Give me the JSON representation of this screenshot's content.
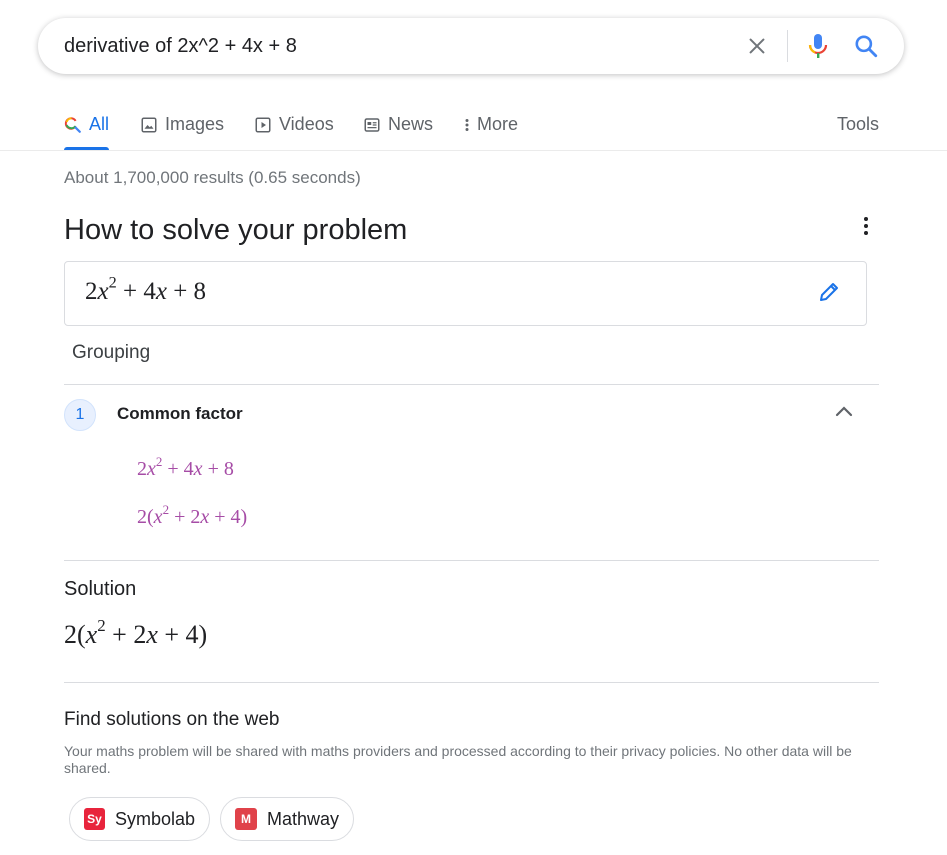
{
  "search": {
    "query": "derivative of 2x^2 + 4x + 8",
    "icons": [
      "close-icon",
      "microphone-icon",
      "search-icon"
    ]
  },
  "tabs": [
    {
      "label": "All",
      "icon": "search-icon",
      "active": true
    },
    {
      "label": "Images",
      "icon": "image-icon"
    },
    {
      "label": "Videos",
      "icon": "play-icon"
    },
    {
      "label": "News",
      "icon": "newspaper-icon"
    },
    {
      "label": "More",
      "icon": "more-vertical-icon"
    }
  ],
  "tools_label": "Tools",
  "result_stats": "About 1,700,000 results (0.65 seconds)",
  "card": {
    "title": "How to solve your problem",
    "method": "Grouping",
    "step": {
      "number": "1",
      "title": "Common factor"
    },
    "solution_label": "Solution"
  },
  "web": {
    "title": "Find solutions on the web",
    "disclaimer": "Your maths problem will be shared with maths providers and processed according to their privacy policies. No other data will be shared.",
    "providers": [
      {
        "name": "Symbolab",
        "logo_text": "Sy",
        "color": "#e8243c"
      },
      {
        "name": "Mathway",
        "logo_text": "M",
        "color": "#e0424a"
      }
    ]
  },
  "colors": {
    "accent": "#1a73e8",
    "step_math": "#a64ca6",
    "muted": "#70757a"
  }
}
